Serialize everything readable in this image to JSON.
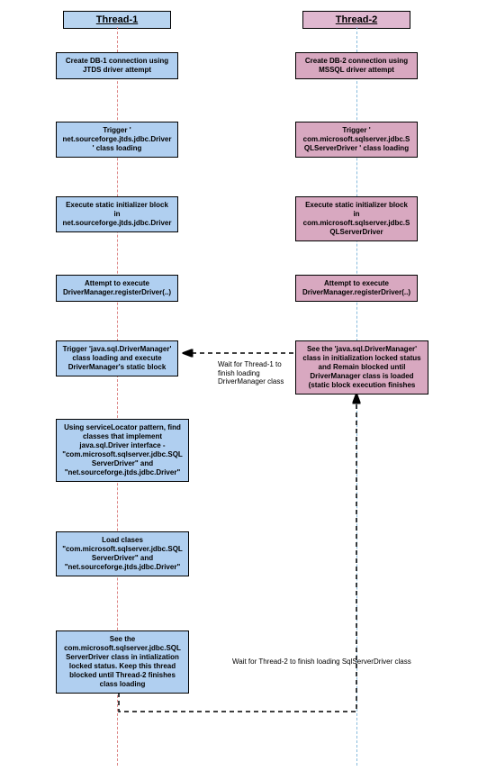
{
  "header": {
    "thread1": "Thread-1",
    "thread2": "Thread-2"
  },
  "t1": {
    "b1": "Create DB-1 connection using JTDS driver attempt",
    "b2": "Trigger ' net.sourceforge.jtds.jdbc.Driver' class loading",
    "b3": "Execute static initializer block in net.sourceforge.jtds.jdbc.Driver",
    "b4": "Attempt to execute DriverManager.registerDriver(..)",
    "b5": "Trigger 'java.sql.DriverManager' class loading and execute DriverManager's static block",
    "b6": "Using serviceLocator pattern, find classes that implement java.sql.Driver interface - \"com.microsoft.sqlserver.jdbc.SQLServerDriver\" and \"net.sourceforge.jtds.jdbc.Driver\"",
    "b7": "Load clases \"com.microsoft.sqlserver.jdbc.SQLServerDriver\" and \"net.sourceforge.jtds.jdbc.Driver\"",
    "b8": "See the com.microsoft.sqlserver.jdbc.SQLServerDriver class in intialization locked status. Keep this thread blocked until Thread-2 finishes class loading"
  },
  "t2": {
    "b1": "Create DB-2 connection using MSSQL driver attempt",
    "b2": "Trigger ' com.microsoft.sqlserver.jdbc.SQLServerDriver ' class loading",
    "b3": "Execute static initializer block in com.microsoft.sqlserver.jdbc.SQLServerDriver",
    "b4": "Attempt to execute DriverManager.registerDriver(..)",
    "b5": "See the 'java.sql.DriverManager' class in initialization locked status and Remain blocked until DriverManager class is loaded (static block execution finishes"
  },
  "labels": {
    "l1": "Wait for Thread-1 to finish loading DriverManager class",
    "l2": "Wait for Thread-2 to finish loading SqlServerDriver class"
  }
}
